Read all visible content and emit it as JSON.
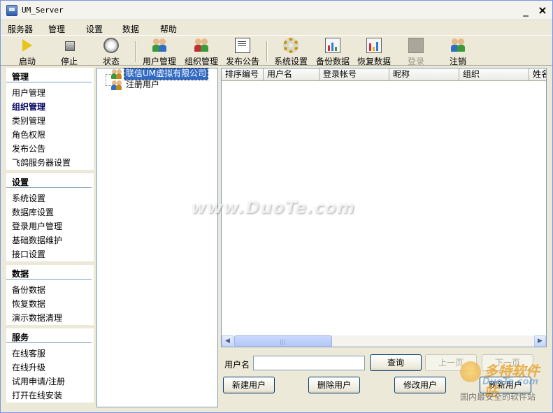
{
  "window": {
    "title": "UM_Server",
    "minimize": "_",
    "close": "×"
  },
  "menu": [
    "服务器",
    "管理",
    "设置",
    "数据",
    "帮助"
  ],
  "toolbar": [
    {
      "label": "启动",
      "icon": "play-icon",
      "enabled": true
    },
    {
      "label": "停止",
      "icon": "stop-icon",
      "enabled": true
    },
    {
      "label": "状态",
      "icon": "status-icon",
      "enabled": true
    },
    {
      "label": "用户管理",
      "icon": "user-management-icon",
      "enabled": true
    },
    {
      "label": "组织管理",
      "icon": "organization-icon",
      "enabled": true
    },
    {
      "label": "发布公告",
      "icon": "notice-icon",
      "enabled": true
    },
    {
      "label": "系统设置",
      "icon": "gear-icon",
      "enabled": true
    },
    {
      "label": "备份数据",
      "icon": "backup-icon",
      "enabled": true
    },
    {
      "label": "恢复数据",
      "icon": "restore-icon",
      "enabled": true
    },
    {
      "label": "登录",
      "icon": "login-icon",
      "enabled": false
    },
    {
      "label": "注销",
      "icon": "logout-icon",
      "enabled": true
    }
  ],
  "nav": [
    {
      "header": "管理",
      "items": [
        "用户管理",
        "组织管理",
        "类别管理",
        "角色权限",
        "发布公告",
        "飞鸽服务器设置"
      ],
      "active": 1
    },
    {
      "header": "设置",
      "items": [
        "系统设置",
        "数据库设置",
        "登录用户管理",
        "基础数据维护",
        "接口设置"
      ]
    },
    {
      "header": "数据",
      "items": [
        "备份数据",
        "恢复数据",
        "演示数据清理"
      ]
    },
    {
      "header": "服务",
      "items": [
        "在线客服",
        "在线升级",
        "试用申请/注册",
        "打开在线安装"
      ]
    }
  ],
  "tree": {
    "root": "联信UM虚拟有限公司",
    "child": "注册用户"
  },
  "grid": {
    "columns": [
      "排序编号",
      "用户名",
      "登录帐号",
      "昵称",
      "组织",
      "姓名"
    ],
    "rows": []
  },
  "controls": {
    "username_label": "用户名",
    "username_value": "",
    "query": "查询",
    "prev_page": "上一页",
    "next_page": "下一页",
    "new_user": "新建用户",
    "delete_user": "删除用户",
    "edit_user": "修改用户",
    "refresh_user": "刷新用户"
  },
  "watermark": {
    "text": "www.DuoTe.com",
    "logo_name": "多特软件站",
    "logo_domain": "DuoTe.com",
    "logo_slogan": "国内最安全的软件站"
  },
  "colors": {
    "selection": "#316ac5",
    "border": "#7f9db9",
    "rule": "#7b9ebd",
    "face": "#ece9d8"
  }
}
